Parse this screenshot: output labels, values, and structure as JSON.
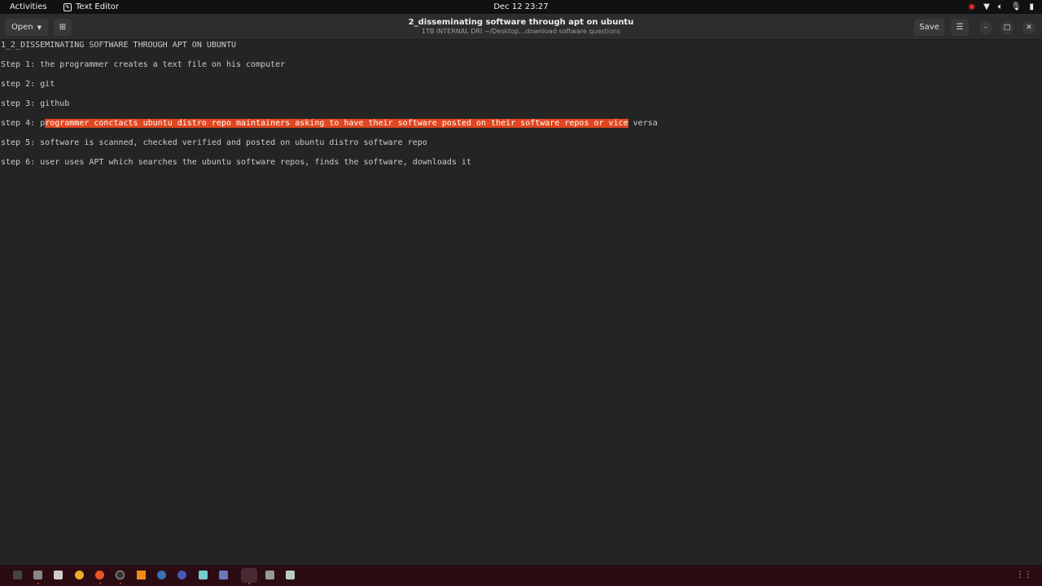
{
  "topbar": {
    "activities": "Activities",
    "app_name": "Text Editor",
    "clock": "Dec 12  23:27"
  },
  "header": {
    "open_label": "Open",
    "title": "2_disseminating software through apt on ubuntu",
    "subtitle": "1TB INTERNAL DRI ~/Desktop…download software questions",
    "save_label": "Save"
  },
  "document": {
    "lines": [
      "1_2_DISSEMINATING SOFTWARE THROUGH APT ON UBUNTU",
      "Step 1: the programmer creates a text file on his computer",
      "step 2: git",
      "step 3: github",
      "step 5: software is scanned, checked verified and posted on ubuntu distro software repo",
      "step 6: user uses APT which searches the ubuntu software repos, finds the software, downloads it"
    ],
    "step4": {
      "before": "step 4: p",
      "selected": "rogrammer conctacts ubuntu distro repo maintainers asking to have their software posted on their software repos or vice",
      "after": " versa"
    }
  },
  "colors": {
    "selection": "#e0461f",
    "dock": "#2b0c12"
  }
}
